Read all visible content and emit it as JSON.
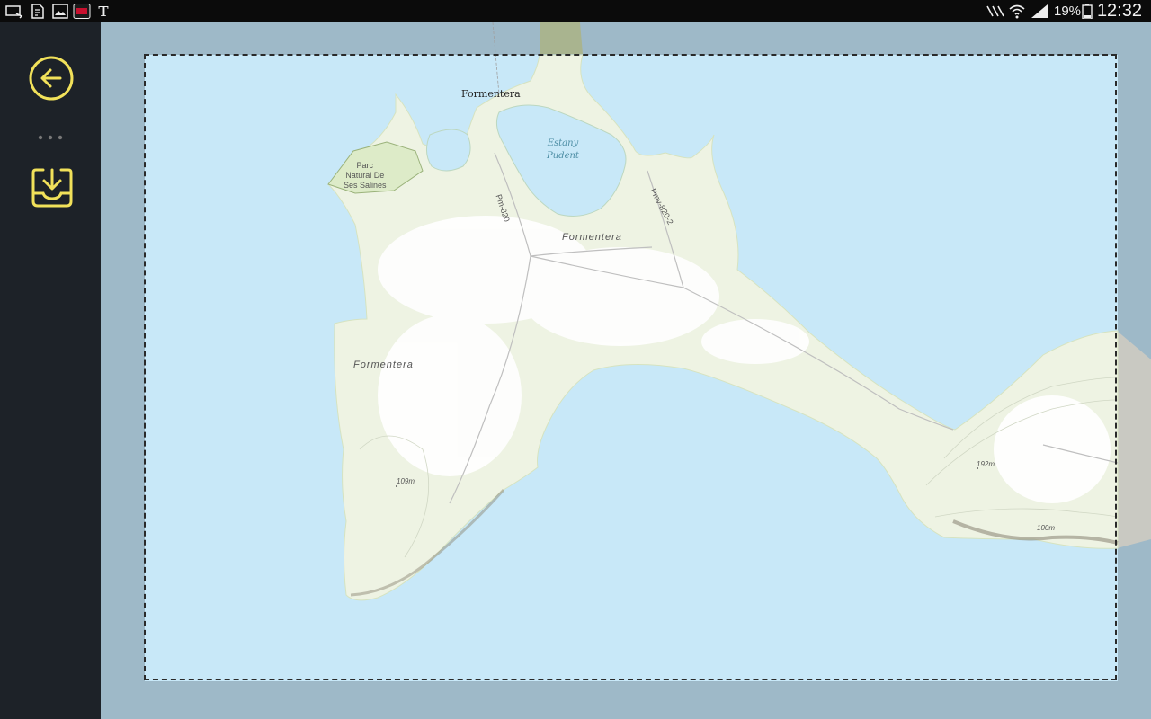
{
  "status_bar": {
    "time": "12:32",
    "battery_percent": "19%",
    "left_icons": [
      "cast-icon",
      "sim-card-icon",
      "gallery-icon",
      "news-app-icon",
      "nyt-icon"
    ],
    "right_icons": [
      "nfc-icon",
      "wifi-icon",
      "signal-icon",
      "battery-icon"
    ]
  },
  "sidebar": {
    "back_icon": "arrow-left-circle-icon",
    "more_icon": "more-dots-icon",
    "download_icon": "download-tray-icon",
    "accent_color": "#f1e15a"
  },
  "map": {
    "labels": {
      "town_north": "Formentera",
      "lagoon": [
        "Estany",
        "Pudent"
      ],
      "park": [
        "Parc",
        "Natural De",
        "Ses Salines"
      ],
      "road_pm820": "Pm-820",
      "road_pmv820": "Pmv-820-2",
      "island_center": "Formentera",
      "island_west": "Formentera",
      "elev_west": "109m",
      "elev_east": "192m",
      "elev_contour": "100m"
    },
    "colors": {
      "sea": "#c8e8f8",
      "outside": "#9eb9c8",
      "land": "#eef3e3",
      "park": "#ddebc8",
      "urban": "#ffffff"
    }
  }
}
